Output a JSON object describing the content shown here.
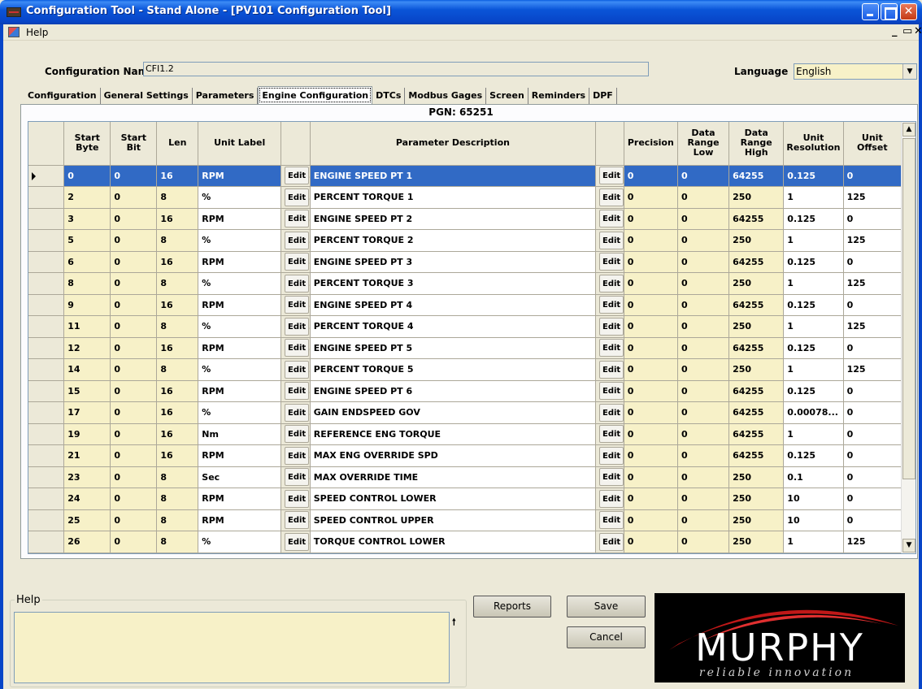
{
  "window": {
    "title": "Configuration Tool - Stand Alone - [PV101 Configuration Tool]"
  },
  "menu": {
    "help": "Help"
  },
  "config": {
    "name_label": "Configuration Name:",
    "name_value": "CFI1.2",
    "language_label": "Language",
    "language_value": "English"
  },
  "tabs": [
    {
      "label": "Configuration"
    },
    {
      "label": "General Settings"
    },
    {
      "label": "Parameters"
    },
    {
      "label": "Engine Configuration",
      "active": true
    },
    {
      "label": "DTCs"
    },
    {
      "label": "Modbus Gages"
    },
    {
      "label": "Screen"
    },
    {
      "label": "Reminders"
    },
    {
      "label": "DPF"
    }
  ],
  "pgn_label": "PGN: 65251",
  "grid": {
    "edit_label": "Edit",
    "columns": [
      "Start Byte",
      "Start Bit",
      "Len",
      "Unit Label",
      "",
      "Parameter Description",
      "",
      "Precision",
      "Data Range Low",
      "Data Range High",
      "Unit Resolution",
      "Unit Offset"
    ],
    "rows": [
      {
        "start_byte": "0",
        "start_bit": "0",
        "len": "16",
        "unit": "RPM",
        "desc": "ENGINE SPEED PT 1",
        "precision": "0",
        "low": "0",
        "high": "64255",
        "res": "0.125",
        "offset": "0",
        "selected": true
      },
      {
        "start_byte": "2",
        "start_bit": "0",
        "len": "8",
        "unit": "%",
        "desc": "PERCENT TORQUE 1",
        "precision": "0",
        "low": "0",
        "high": "250",
        "res": "1",
        "offset": "125"
      },
      {
        "start_byte": "3",
        "start_bit": "0",
        "len": "16",
        "unit": "RPM",
        "desc": "ENGINE SPEED PT 2",
        "precision": "0",
        "low": "0",
        "high": "64255",
        "res": "0.125",
        "offset": "0"
      },
      {
        "start_byte": "5",
        "start_bit": "0",
        "len": "8",
        "unit": "%",
        "desc": "PERCENT TORQUE 2",
        "precision": "0",
        "low": "0",
        "high": "250",
        "res": "1",
        "offset": "125"
      },
      {
        "start_byte": "6",
        "start_bit": "0",
        "len": "16",
        "unit": "RPM",
        "desc": "ENGINE SPEED PT 3",
        "precision": "0",
        "low": "0",
        "high": "64255",
        "res": "0.125",
        "offset": "0"
      },
      {
        "start_byte": "8",
        "start_bit": "0",
        "len": "8",
        "unit": "%",
        "desc": "PERCENT TORQUE 3",
        "precision": "0",
        "low": "0",
        "high": "250",
        "res": "1",
        "offset": "125"
      },
      {
        "start_byte": "9",
        "start_bit": "0",
        "len": "16",
        "unit": "RPM",
        "desc": "ENGINE SPEED PT 4",
        "precision": "0",
        "low": "0",
        "high": "64255",
        "res": "0.125",
        "offset": "0"
      },
      {
        "start_byte": "11",
        "start_bit": "0",
        "len": "8",
        "unit": "%",
        "desc": "PERCENT TORQUE 4",
        "precision": "0",
        "low": "0",
        "high": "250",
        "res": "1",
        "offset": "125"
      },
      {
        "start_byte": "12",
        "start_bit": "0",
        "len": "16",
        "unit": "RPM",
        "desc": "ENGINE SPEED PT 5",
        "precision": "0",
        "low": "0",
        "high": "64255",
        "res": "0.125",
        "offset": "0"
      },
      {
        "start_byte": "14",
        "start_bit": "0",
        "len": "8",
        "unit": "%",
        "desc": "PERCENT TORQUE 5",
        "precision": "0",
        "low": "0",
        "high": "250",
        "res": "1",
        "offset": "125"
      },
      {
        "start_byte": "15",
        "start_bit": "0",
        "len": "16",
        "unit": "RPM",
        "desc": "ENGINE SPEED PT 6",
        "precision": "0",
        "low": "0",
        "high": "64255",
        "res": "0.125",
        "offset": "0"
      },
      {
        "start_byte": "17",
        "start_bit": "0",
        "len": "16",
        "unit": "%",
        "desc": "GAIN ENDSPEED GOV",
        "precision": "0",
        "low": "0",
        "high": "64255",
        "res": "0.00078...",
        "offset": "0"
      },
      {
        "start_byte": "19",
        "start_bit": "0",
        "len": "16",
        "unit": "Nm",
        "desc": "REFERENCE ENG TORQUE",
        "precision": "0",
        "low": "0",
        "high": "64255",
        "res": "1",
        "offset": "0"
      },
      {
        "start_byte": "21",
        "start_bit": "0",
        "len": "16",
        "unit": "RPM",
        "desc": "MAX ENG OVERRIDE SPD",
        "precision": "0",
        "low": "0",
        "high": "64255",
        "res": "0.125",
        "offset": "0"
      },
      {
        "start_byte": "23",
        "start_bit": "0",
        "len": "8",
        "unit": "Sec",
        "desc": "MAX OVERRIDE TIME",
        "precision": "0",
        "low": "0",
        "high": "250",
        "res": "0.1",
        "offset": "0"
      },
      {
        "start_byte": "24",
        "start_bit": "0",
        "len": "8",
        "unit": "RPM",
        "desc": "SPEED CONTROL LOWER",
        "precision": "0",
        "low": "0",
        "high": "250",
        "res": "10",
        "offset": "0"
      },
      {
        "start_byte": "25",
        "start_bit": "0",
        "len": "8",
        "unit": "RPM",
        "desc": "SPEED CONTROL UPPER",
        "precision": "0",
        "low": "0",
        "high": "250",
        "res": "10",
        "offset": "0"
      },
      {
        "start_byte": "26",
        "start_bit": "0",
        "len": "8",
        "unit": "%",
        "desc": "TORQUE CONTROL LOWER",
        "precision": "0",
        "low": "0",
        "high": "250",
        "res": "1",
        "offset": "125"
      }
    ]
  },
  "help_panel": {
    "legend": "Help",
    "text": ""
  },
  "buttons": {
    "reports": "Reports",
    "save": "Save",
    "cancel": "Cancel"
  },
  "logo": {
    "brand": "MURPHY",
    "tagline": "reliable innovation"
  },
  "colors": {
    "titlebar": "#0a55d8",
    "selection": "#316ac5",
    "yellow_cell": "#f7f1c8",
    "logo_swoosh": "#c01818"
  }
}
